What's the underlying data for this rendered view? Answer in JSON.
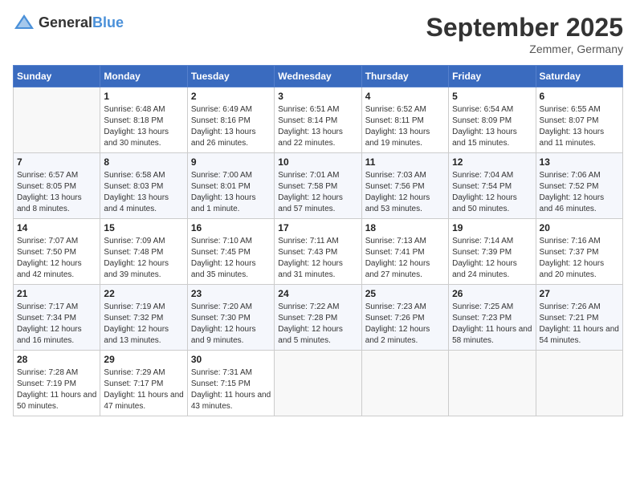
{
  "header": {
    "logo_general": "General",
    "logo_blue": "Blue",
    "title": "September 2025",
    "location": "Zemmer, Germany"
  },
  "calendar": {
    "weekdays": [
      "Sunday",
      "Monday",
      "Tuesday",
      "Wednesday",
      "Thursday",
      "Friday",
      "Saturday"
    ],
    "rows": [
      [
        {
          "day": "",
          "empty": true
        },
        {
          "day": "1",
          "sunrise": "Sunrise: 6:48 AM",
          "sunset": "Sunset: 8:18 PM",
          "daylight": "Daylight: 13 hours and 30 minutes."
        },
        {
          "day": "2",
          "sunrise": "Sunrise: 6:49 AM",
          "sunset": "Sunset: 8:16 PM",
          "daylight": "Daylight: 13 hours and 26 minutes."
        },
        {
          "day": "3",
          "sunrise": "Sunrise: 6:51 AM",
          "sunset": "Sunset: 8:14 PM",
          "daylight": "Daylight: 13 hours and 22 minutes."
        },
        {
          "day": "4",
          "sunrise": "Sunrise: 6:52 AM",
          "sunset": "Sunset: 8:11 PM",
          "daylight": "Daylight: 13 hours and 19 minutes."
        },
        {
          "day": "5",
          "sunrise": "Sunrise: 6:54 AM",
          "sunset": "Sunset: 8:09 PM",
          "daylight": "Daylight: 13 hours and 15 minutes."
        },
        {
          "day": "6",
          "sunrise": "Sunrise: 6:55 AM",
          "sunset": "Sunset: 8:07 PM",
          "daylight": "Daylight: 13 hours and 11 minutes."
        }
      ],
      [
        {
          "day": "7",
          "sunrise": "Sunrise: 6:57 AM",
          "sunset": "Sunset: 8:05 PM",
          "daylight": "Daylight: 13 hours and 8 minutes."
        },
        {
          "day": "8",
          "sunrise": "Sunrise: 6:58 AM",
          "sunset": "Sunset: 8:03 PM",
          "daylight": "Daylight: 13 hours and 4 minutes."
        },
        {
          "day": "9",
          "sunrise": "Sunrise: 7:00 AM",
          "sunset": "Sunset: 8:01 PM",
          "daylight": "Daylight: 13 hours and 1 minute."
        },
        {
          "day": "10",
          "sunrise": "Sunrise: 7:01 AM",
          "sunset": "Sunset: 7:58 PM",
          "daylight": "Daylight: 12 hours and 57 minutes."
        },
        {
          "day": "11",
          "sunrise": "Sunrise: 7:03 AM",
          "sunset": "Sunset: 7:56 PM",
          "daylight": "Daylight: 12 hours and 53 minutes."
        },
        {
          "day": "12",
          "sunrise": "Sunrise: 7:04 AM",
          "sunset": "Sunset: 7:54 PM",
          "daylight": "Daylight: 12 hours and 50 minutes."
        },
        {
          "day": "13",
          "sunrise": "Sunrise: 7:06 AM",
          "sunset": "Sunset: 7:52 PM",
          "daylight": "Daylight: 12 hours and 46 minutes."
        }
      ],
      [
        {
          "day": "14",
          "sunrise": "Sunrise: 7:07 AM",
          "sunset": "Sunset: 7:50 PM",
          "daylight": "Daylight: 12 hours and 42 minutes."
        },
        {
          "day": "15",
          "sunrise": "Sunrise: 7:09 AM",
          "sunset": "Sunset: 7:48 PM",
          "daylight": "Daylight: 12 hours and 39 minutes."
        },
        {
          "day": "16",
          "sunrise": "Sunrise: 7:10 AM",
          "sunset": "Sunset: 7:45 PM",
          "daylight": "Daylight: 12 hours and 35 minutes."
        },
        {
          "day": "17",
          "sunrise": "Sunrise: 7:11 AM",
          "sunset": "Sunset: 7:43 PM",
          "daylight": "Daylight: 12 hours and 31 minutes."
        },
        {
          "day": "18",
          "sunrise": "Sunrise: 7:13 AM",
          "sunset": "Sunset: 7:41 PM",
          "daylight": "Daylight: 12 hours and 27 minutes."
        },
        {
          "day": "19",
          "sunrise": "Sunrise: 7:14 AM",
          "sunset": "Sunset: 7:39 PM",
          "daylight": "Daylight: 12 hours and 24 minutes."
        },
        {
          "day": "20",
          "sunrise": "Sunrise: 7:16 AM",
          "sunset": "Sunset: 7:37 PM",
          "daylight": "Daylight: 12 hours and 20 minutes."
        }
      ],
      [
        {
          "day": "21",
          "sunrise": "Sunrise: 7:17 AM",
          "sunset": "Sunset: 7:34 PM",
          "daylight": "Daylight: 12 hours and 16 minutes."
        },
        {
          "day": "22",
          "sunrise": "Sunrise: 7:19 AM",
          "sunset": "Sunset: 7:32 PM",
          "daylight": "Daylight: 12 hours and 13 minutes."
        },
        {
          "day": "23",
          "sunrise": "Sunrise: 7:20 AM",
          "sunset": "Sunset: 7:30 PM",
          "daylight": "Daylight: 12 hours and 9 minutes."
        },
        {
          "day": "24",
          "sunrise": "Sunrise: 7:22 AM",
          "sunset": "Sunset: 7:28 PM",
          "daylight": "Daylight: 12 hours and 5 minutes."
        },
        {
          "day": "25",
          "sunrise": "Sunrise: 7:23 AM",
          "sunset": "Sunset: 7:26 PM",
          "daylight": "Daylight: 12 hours and 2 minutes."
        },
        {
          "day": "26",
          "sunrise": "Sunrise: 7:25 AM",
          "sunset": "Sunset: 7:23 PM",
          "daylight": "Daylight: 11 hours and 58 minutes."
        },
        {
          "day": "27",
          "sunrise": "Sunrise: 7:26 AM",
          "sunset": "Sunset: 7:21 PM",
          "daylight": "Daylight: 11 hours and 54 minutes."
        }
      ],
      [
        {
          "day": "28",
          "sunrise": "Sunrise: 7:28 AM",
          "sunset": "Sunset: 7:19 PM",
          "daylight": "Daylight: 11 hours and 50 minutes."
        },
        {
          "day": "29",
          "sunrise": "Sunrise: 7:29 AM",
          "sunset": "Sunset: 7:17 PM",
          "daylight": "Daylight: 11 hours and 47 minutes."
        },
        {
          "day": "30",
          "sunrise": "Sunrise: 7:31 AM",
          "sunset": "Sunset: 7:15 PM",
          "daylight": "Daylight: 11 hours and 43 minutes."
        },
        {
          "day": "",
          "empty": true
        },
        {
          "day": "",
          "empty": true
        },
        {
          "day": "",
          "empty": true
        },
        {
          "day": "",
          "empty": true
        }
      ]
    ]
  }
}
